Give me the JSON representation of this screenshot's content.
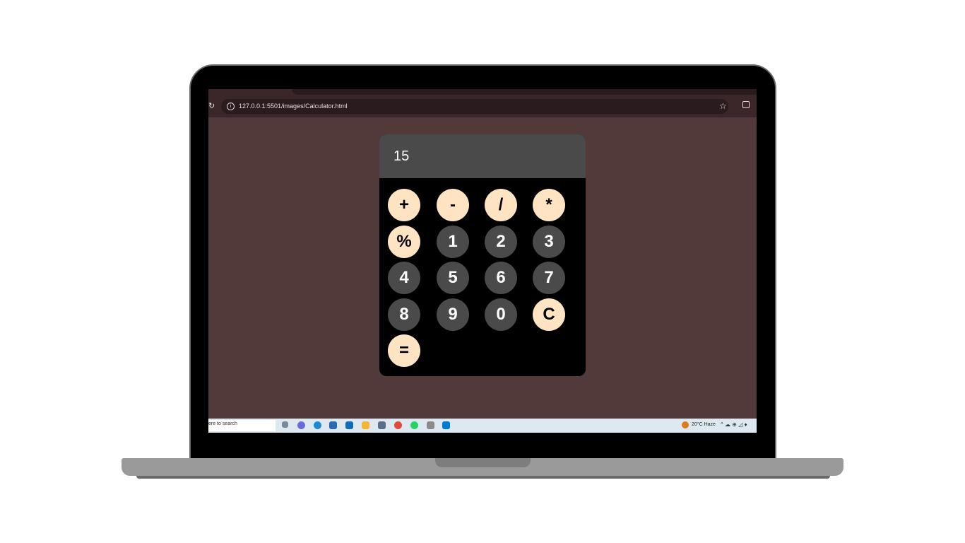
{
  "browser": {
    "url": "127.0.0.1:5501/images/Calculator.html"
  },
  "calculator": {
    "display": "15",
    "keys": [
      {
        "label": "+",
        "kind": "operator"
      },
      {
        "label": "-",
        "kind": "operator"
      },
      {
        "label": "/",
        "kind": "operator"
      },
      {
        "label": "*",
        "kind": "operator"
      },
      {
        "label": "%",
        "kind": "operator"
      },
      {
        "label": "1",
        "kind": "digit"
      },
      {
        "label": "2",
        "kind": "digit"
      },
      {
        "label": "3",
        "kind": "digit"
      },
      {
        "label": "4",
        "kind": "digit"
      },
      {
        "label": "5",
        "kind": "digit"
      },
      {
        "label": "6",
        "kind": "digit"
      },
      {
        "label": "7",
        "kind": "digit"
      },
      {
        "label": "8",
        "kind": "digit"
      },
      {
        "label": "9",
        "kind": "digit"
      },
      {
        "label": "0",
        "kind": "digit"
      },
      {
        "label": "C",
        "kind": "operator"
      },
      {
        "label": "=",
        "kind": "operator"
      }
    ],
    "colors": {
      "operator_key": "#ffe4c4",
      "digit_key": "#4a4a4a",
      "display_bg": "#4a4a4a",
      "body_bg": "#000000",
      "page_bg": "#52393a"
    }
  },
  "taskbar": {
    "search_text": "ere to search",
    "weather": "20°C  Haze",
    "tray_icons": "^ ☁ ⊕ ◿ ♦"
  }
}
